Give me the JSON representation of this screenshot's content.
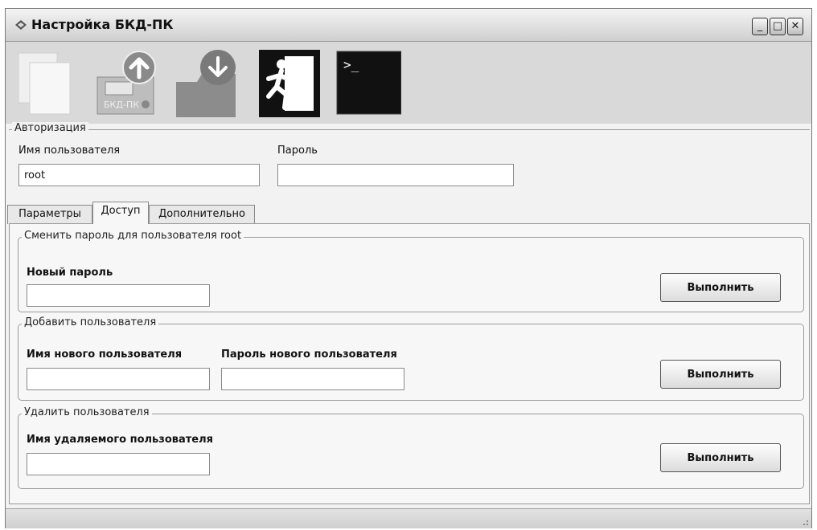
{
  "window": {
    "title": "Настройка БКД-ПК",
    "controls": [
      "minimize",
      "maximize",
      "close"
    ]
  },
  "toolbar": {
    "items": [
      {
        "name": "new-document-icon"
      },
      {
        "name": "upload-config-icon",
        "caption": "БКД-ПК"
      },
      {
        "name": "download-config-icon"
      },
      {
        "name": "exit-icon"
      },
      {
        "name": "terminal-icon",
        "prompt": ">_"
      }
    ]
  },
  "auth": {
    "legend": "Авторизация",
    "username_label": "Имя пользователя",
    "username_value": "root",
    "password_label": "Пароль",
    "password_value": ""
  },
  "tabs": {
    "items": [
      "Параметры",
      "Доступ",
      "Дополнительно"
    ],
    "active": "Доступ"
  },
  "change_password": {
    "legend": "Сменить пароль для пользователя root",
    "label": "Новый пароль",
    "value": "",
    "button": "Выполнить"
  },
  "add_user": {
    "legend": "Добавить пользователя",
    "name_label": "Имя нового пользователя",
    "name_value": "",
    "password_label": "Пароль нового пользователя",
    "password_value": "",
    "button": "Выполнить"
  },
  "delete_user": {
    "legend": "Удалить пользователя",
    "label": "Имя удаляемого пользователя",
    "value": "",
    "button": "Выполнить"
  }
}
